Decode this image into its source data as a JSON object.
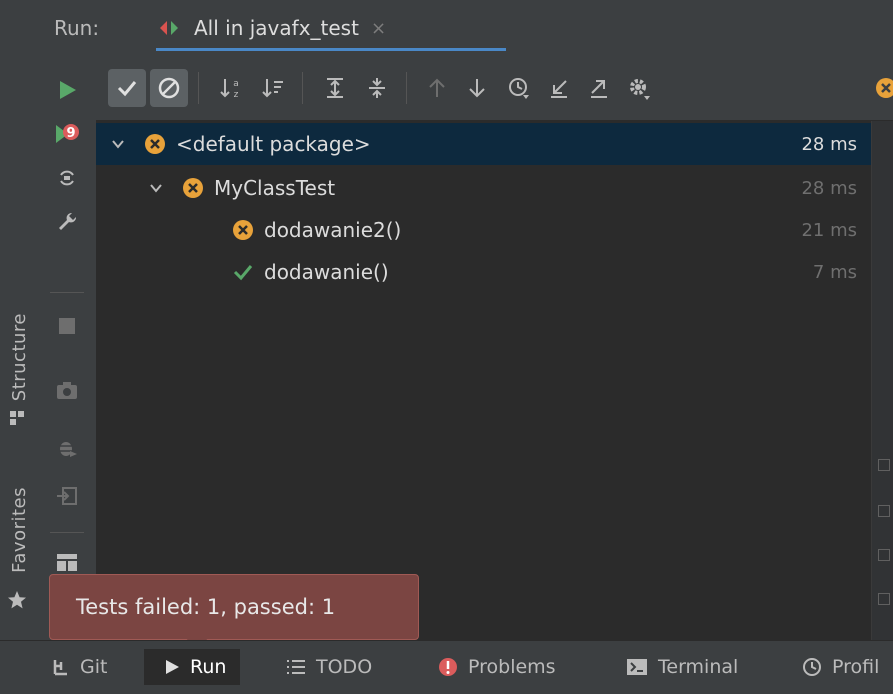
{
  "side_tabs": [
    {
      "label": "Structure",
      "icon": "structure-icon"
    },
    {
      "label": "Favorites",
      "icon": "star-icon"
    }
  ],
  "header": {
    "title": "Run:",
    "tab_label": "All in javafx_test",
    "tab_close": "×"
  },
  "tree": {
    "rows": [
      {
        "label": "<default package>",
        "time": "28 ms",
        "status": "failed",
        "selected": true
      },
      {
        "label": "MyClassTest",
        "time": "28 ms",
        "status": "failed",
        "selected": false
      },
      {
        "label": "dodawanie2()",
        "time": "21 ms",
        "status": "failed",
        "selected": false
      },
      {
        "label": "dodawanie()",
        "time": "7 ms",
        "status": "passed",
        "selected": false
      }
    ]
  },
  "balloon": {
    "text": "Tests failed: 1, passed: 1"
  },
  "bottom_bar": {
    "tabs": [
      {
        "label": "Git",
        "icon": "git-icon"
      },
      {
        "label": "Run",
        "icon": "run-icon",
        "active": true
      },
      {
        "label": "TODO",
        "icon": "todo-icon"
      },
      {
        "label": "Problems",
        "icon": "problems-icon"
      },
      {
        "label": "Terminal",
        "icon": "terminal-icon"
      },
      {
        "label": "Profil",
        "icon": "profiler-icon"
      }
    ]
  },
  "colors": {
    "accent_blue": "#4a88c7",
    "run_green": "#59a869",
    "fail_orange": "#e8a23a",
    "balloon_bg": "#7b4542"
  }
}
